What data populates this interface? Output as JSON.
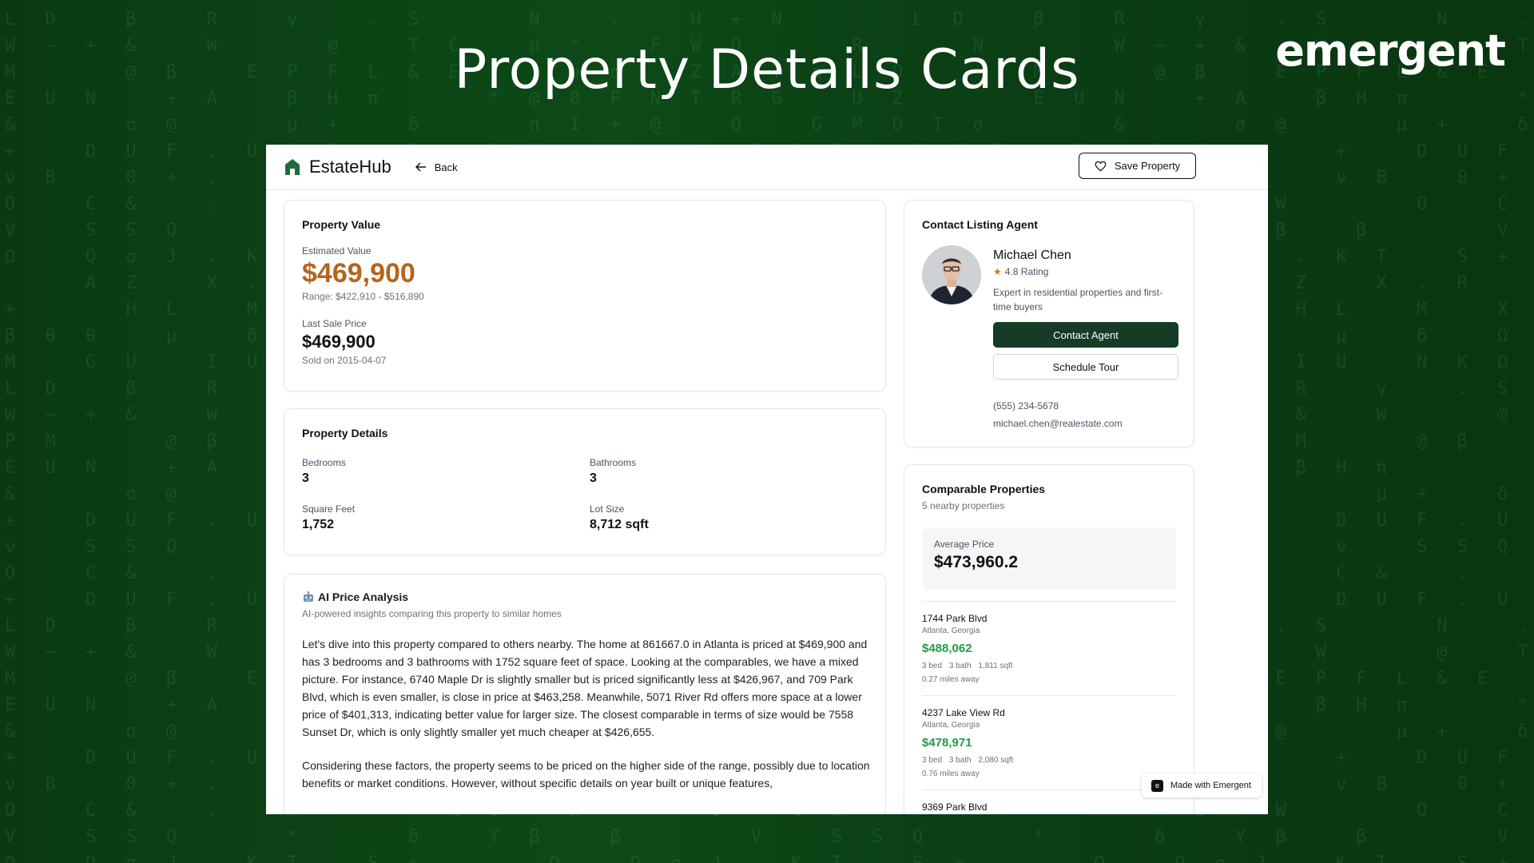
{
  "banner": {
    "title": "Property Details Cards",
    "brand": "emergent"
  },
  "background_glyphs": [
    "L D   β   R   γ   . S     N   .   H + N",
    "W − + &   W     @   T C   μ *   F W Q     R     N",
    "M     @ β   E P F L & E   . ν σ   Z A T σ L O",
    "E U N   + A   β H π     * @ 0 F N T R G   U Z",
    "&     σ @     μ +   δ     π I + @   Q   G M O T σ",
    "+   D U F . U V S   S   L K",
    "ν B   0 + .   P + K   . T μ",
    "O   C &   .   M       π σ   W",
    "V   S S Q     *     δ   Y β   β",
    "Ω   Q σ J . K T   S +",
    "    A Z   X . R   +   *",
    "+     H L   M   X & H P",
    "β θ θ   μ   δ   Ω P   C",
    "M   G U   I U   N K Ω",
    "L D   β   R   γ   . S",
    "W − + &   W     @   T C",
    "P M     @ β   E P F L & E",
    "E U N   + A   β H π",
    "&     σ @     μ +   δ",
    "+   D U F . U V S   S   L",
    "ν   S S Q     *     δ   Y β",
    "O   C &   .   M       π σ",
    "+   D U F . U V S   S   L"
  ],
  "app": {
    "name": "EstateHub",
    "back_label": "Back",
    "save_label": "Save Property"
  },
  "value_card": {
    "title": "Property Value",
    "estimated_label": "Estimated Value",
    "estimated_value": "$469,900",
    "range": "Range: $422,910 - $516,890",
    "last_sale_label": "Last Sale Price",
    "last_sale_value": "$469,900",
    "sold_on": "Sold on 2015-04-07",
    "accent_color": "#b5651d"
  },
  "details_card": {
    "title": "Property Details",
    "items": [
      {
        "label": "Bedrooms",
        "value": "3"
      },
      {
        "label": "Bathrooms",
        "value": "3"
      },
      {
        "label": "Square Feet",
        "value": "1,752"
      },
      {
        "label": "Lot Size",
        "value": "8,712 sqft"
      }
    ]
  },
  "ai_card": {
    "icon": "robot-icon",
    "title": "AI Price Analysis",
    "subtitle": "AI-powered insights comparing this property to similar homes",
    "paragraph1": "Let's dive into this property compared to others nearby. The home at 861667.0 in Atlanta is priced at $469,900 and has 3 bedrooms and 3 bathrooms with 1752 square feet of space. Looking at the comparables, we have a mixed picture. For instance, 6740 Maple Dr is slightly smaller but is priced significantly less at $426,967, and 709 Park Blvd, which is even smaller, is close in price at $463,258. Meanwhile, 5071 River Rd offers more space at a lower price of $401,313, indicating better value for larger size. The closest comparable in terms of size would be 7558 Sunset Dr, which is only slightly smaller yet much cheaper at $426,655.",
    "paragraph2": "Considering these factors, the property seems to be priced on the higher side of the range, possibly due to location benefits or market conditions. However, without specific details on year built or unique features,"
  },
  "agent_card": {
    "title": "Contact Listing Agent",
    "name": "Michael Chen",
    "rating": "4.8 Rating",
    "bio": "Expert in residential properties and first-time buyers",
    "contact_button": "Contact Agent",
    "tour_button": "Schedule Tour",
    "phone": "(555) 234-5678",
    "email": "michael.chen@realestate.com",
    "button_color": "#163b26"
  },
  "comparables_card": {
    "title": "Comparable Properties",
    "subtitle": "5 nearby properties",
    "avg_label": "Average Price",
    "avg_value": "$473,960.2",
    "items": [
      {
        "address": "1744 Park Blvd",
        "city": "Atlanta, Georgia",
        "price": "$488,062",
        "beds": "3 bed",
        "baths": "3 bath",
        "sqft": "1,811 sqft",
        "distance": "0.27 miles away"
      },
      {
        "address": "4237 Lake View Rd",
        "city": "Atlanta, Georgia",
        "price": "$478,971",
        "beds": "3 bed",
        "baths": "3 bath",
        "sqft": "2,080 sqft",
        "distance": "0.76 miles away"
      },
      {
        "address": "9369 Park Blvd",
        "city": "",
        "price": "",
        "beds": "",
        "baths": "",
        "sqft": "",
        "distance": ""
      }
    ],
    "price_color": "#1f9d47"
  },
  "made_with": {
    "label": "Made with Emergent"
  }
}
